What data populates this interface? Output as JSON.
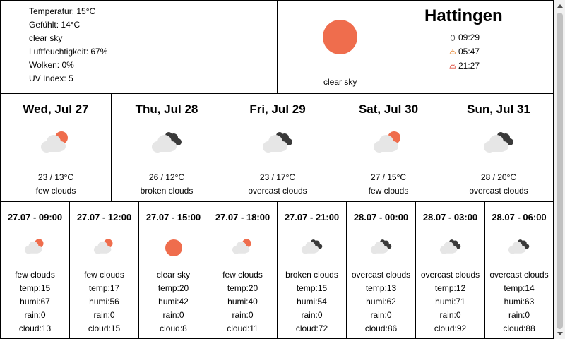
{
  "current": {
    "lines": [
      "Temperatur: 15°C",
      "Gefühlt: 14°C",
      "clear sky",
      "Luftfeuchtigkeit: 67%",
      "Wolken: 0%",
      "UV Index: 5"
    ]
  },
  "city": {
    "name": "Hattingen",
    "description": "clear sky",
    "icon": "sun-icon",
    "moonrise": "09:29",
    "sunrise": "05:47",
    "sunset": "21:27"
  },
  "colors": {
    "sun": "#ef6d4d",
    "cloud_light": "#e6e6e6",
    "cloud_dark": "#3a3a3a",
    "border": "#000000"
  },
  "daily": [
    {
      "date": "Wed, Jul 27",
      "temp": "23 / 13°C",
      "cond": "few clouds",
      "icon": "few-clouds-icon"
    },
    {
      "date": "Thu, Jul 28",
      "temp": "26 / 12°C",
      "cond": "broken clouds",
      "icon": "broken-clouds-icon"
    },
    {
      "date": "Fri, Jul 29",
      "temp": "23 / 17°C",
      "cond": "overcast clouds",
      "icon": "overcast-clouds-icon"
    },
    {
      "date": "Sat, Jul 30",
      "temp": "27 / 15°C",
      "cond": "few clouds",
      "icon": "few-clouds-icon"
    },
    {
      "date": "Sun, Jul 31",
      "temp": "28 / 20°C",
      "cond": "overcast clouds",
      "icon": "overcast-clouds-icon"
    }
  ],
  "hourly": [
    {
      "time": "27.07 - 09:00",
      "cond": "few clouds",
      "temp": "temp:15",
      "humi": "humi:67",
      "rain": "rain:0",
      "cloud": "cloud:13",
      "icon": "few-clouds-icon"
    },
    {
      "time": "27.07 - 12:00",
      "cond": "few clouds",
      "temp": "temp:17",
      "humi": "humi:56",
      "rain": "rain:0",
      "cloud": "cloud:15",
      "icon": "few-clouds-icon"
    },
    {
      "time": "27.07 - 15:00",
      "cond": "clear sky",
      "temp": "temp:20",
      "humi": "humi:42",
      "rain": "rain:0",
      "cloud": "cloud:8",
      "icon": "sun-icon"
    },
    {
      "time": "27.07 - 18:00",
      "cond": "few clouds",
      "temp": "temp:20",
      "humi": "humi:40",
      "rain": "rain:0",
      "cloud": "cloud:11",
      "icon": "few-clouds-icon"
    },
    {
      "time": "27.07 - 21:00",
      "cond": "broken clouds",
      "temp": "temp:15",
      "humi": "humi:54",
      "rain": "rain:0",
      "cloud": "cloud:72",
      "icon": "broken-clouds-icon"
    },
    {
      "time": "28.07 - 00:00",
      "cond": "overcast clouds",
      "temp": "temp:13",
      "humi": "humi:62",
      "rain": "rain:0",
      "cloud": "cloud:86",
      "icon": "overcast-clouds-icon"
    },
    {
      "time": "28.07 - 03:00",
      "cond": "overcast clouds",
      "temp": "temp:12",
      "humi": "humi:71",
      "rain": "rain:0",
      "cloud": "cloud:92",
      "icon": "overcast-clouds-icon"
    },
    {
      "time": "28.07 - 06:00",
      "cond": "overcast clouds",
      "temp": "temp:14",
      "humi": "humi:63",
      "rain": "rain:0",
      "cloud": "cloud:88",
      "icon": "overcast-clouds-icon"
    }
  ]
}
